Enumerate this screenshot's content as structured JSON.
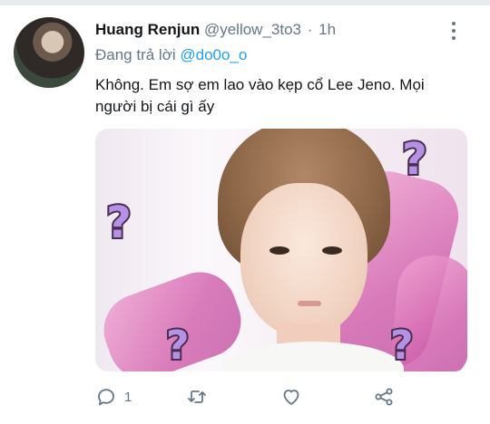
{
  "tweet": {
    "author_name": "Huang Renjun",
    "handle": "@yellow_3to3",
    "separator": "·",
    "time": "1h",
    "reply_prefix": "Đang trả lời",
    "reply_to": "@do0o_o",
    "text": "Không. Em sợ em lao vào kẹp cổ Lee Jeno. Mọi người bị cái gì ấy",
    "media": {
      "overlay_marks": [
        "?",
        "?",
        "?",
        "?"
      ]
    }
  },
  "actions": {
    "reply_count": "1",
    "retweet_count": "",
    "like_count": ""
  },
  "icons": {
    "more": "more-vertical-icon",
    "reply": "reply-icon",
    "retweet": "retweet-icon",
    "like": "heart-icon",
    "share": "share-icon"
  },
  "colors": {
    "accent": "#1da1f2",
    "secondary_text": "#657786",
    "primary_text": "#14171a"
  }
}
